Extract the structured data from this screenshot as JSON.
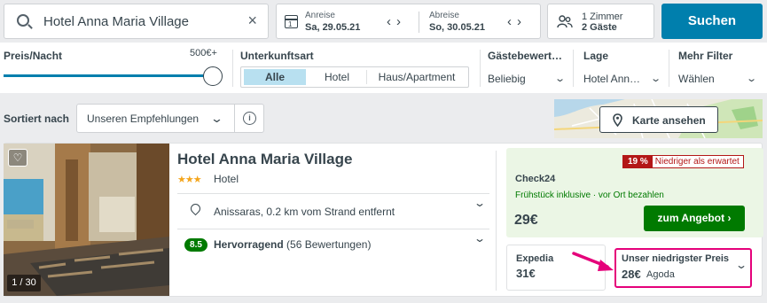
{
  "search": {
    "query": "Hotel Anna Maria Village",
    "clear_icon": "×"
  },
  "dates": {
    "checkin_label": "Anreise",
    "checkin_value": "Sa, 29.05.21",
    "checkout_label": "Abreise",
    "checkout_value": "So, 30.05.21",
    "calendar_day": "1",
    "prev": "‹",
    "next": "›"
  },
  "guests": {
    "rooms": "1 Zimmer",
    "people": "2 Gäste"
  },
  "search_button": "Suchen",
  "filters": {
    "price": {
      "label": "Preis/Nacht",
      "max": "500€+",
      "level_fraction": 1.0
    },
    "type": {
      "label": "Unterkunftsart",
      "options": [
        "Alle",
        "Hotel",
        "Haus/Apartment"
      ],
      "selected": "Alle"
    },
    "rating": {
      "label": "Gästebewert…",
      "value": "Beliebig"
    },
    "location": {
      "label": "Lage",
      "value": "Hotel Ann…"
    },
    "more": {
      "label": "Mehr Filter",
      "value": "Wählen"
    }
  },
  "sort": {
    "label": "Sortiert nach",
    "value": "Unseren Empfehlungen",
    "info_icon": "i"
  },
  "map_button": "Karte ansehen",
  "hotel": {
    "name": "Hotel Anna Maria Village",
    "stars": "★★★",
    "type": "Hotel",
    "location": "Anissaras, 0.2 km vom Strand entfernt",
    "rating_score": "8.5",
    "rating_word": "Hervorragend",
    "rating_count": "(56 Bewertungen)",
    "photo_counter": "1 / 30"
  },
  "best_deal": {
    "badge_pct": "19 %",
    "badge_text": "Niedriger als erwartet",
    "provider": "Check24",
    "perks": "Frühstück inklusive · vor Ort bezahlen",
    "price": "29€",
    "button": "zum Angebot"
  },
  "alt_deal": {
    "provider": "Expedia",
    "price": "31€"
  },
  "lowest_deal": {
    "label": "Unser niedrigster Preis",
    "price": "28€",
    "provider": "Agoda"
  },
  "colors": {
    "primary": "#007fad",
    "deal_green": "#007a00",
    "deal_bg": "#ebf6e5",
    "badge_red": "#b31717",
    "highlight_pink": "#e5007a"
  }
}
